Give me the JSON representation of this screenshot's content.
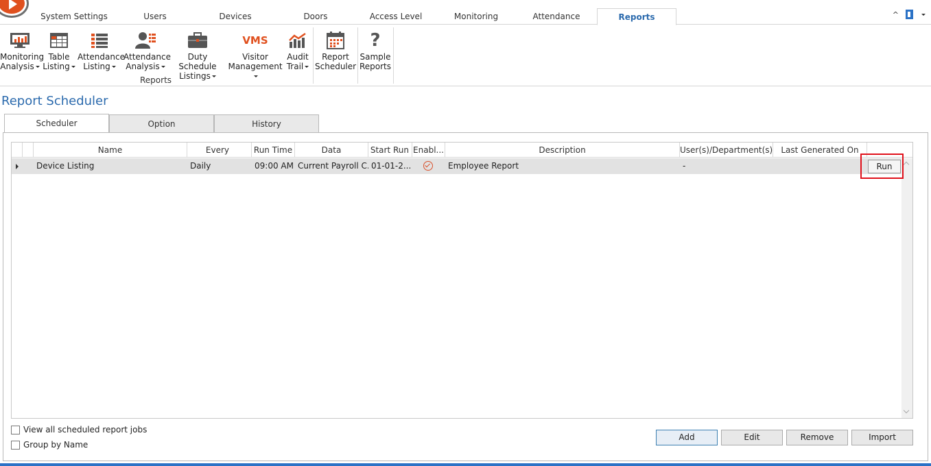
{
  "ribbon": {
    "tabs": [
      "System Settings",
      "Users",
      "Devices",
      "Doors",
      "Access Level",
      "Monitoring",
      "Attendance",
      "Reports"
    ],
    "active_tab": "Reports",
    "buttons": [
      {
        "line1": "Monitoring",
        "line2": "Analysis",
        "icon": "monitor-chart-icon"
      },
      {
        "line1": "Table",
        "line2": "Listing",
        "icon": "table-icon"
      },
      {
        "line1": "Attendance",
        "line2": "Listing",
        "icon": "list-icon"
      },
      {
        "line1": "Attendance",
        "line2": "Analysis",
        "icon": "person-list-icon"
      },
      {
        "line1": "Duty Schedule",
        "line2": "Listings",
        "icon": "briefcase-icon"
      },
      {
        "line1": "Visitor",
        "line2": "Management",
        "icon": "vms-icon",
        "icon_text": "VMS"
      },
      {
        "line1": "Audit",
        "line2": "Trail",
        "icon": "chart-line-icon"
      },
      {
        "line1": "Report",
        "line2": "Scheduler",
        "icon": "calendar-icon"
      },
      {
        "line1": "Sample",
        "line2": "Reports",
        "icon": "question-icon",
        "icon_text": "?"
      }
    ],
    "group_label": "Reports"
  },
  "page": {
    "title": "Report Scheduler",
    "tabs": [
      "Scheduler",
      "Option",
      "History"
    ]
  },
  "grid": {
    "columns": [
      "Name",
      "Every",
      "Run Time",
      "Data",
      "Start Run",
      "Enabl...",
      "Description",
      "User(s)/Department(s)",
      "Last Generated On"
    ],
    "rows": [
      {
        "name": "Device Listing",
        "every": "Daily",
        "run_time": "09:00 AM",
        "data": "Current Payroll C...",
        "start_run": "01-01-2...",
        "enabled": true,
        "description": "Employee Report",
        "users": "-",
        "last_generated": "",
        "action": "Run"
      }
    ]
  },
  "options": {
    "view_all": "View all scheduled report jobs",
    "group_by": "Group by Name"
  },
  "actions": {
    "add": "Add",
    "edit": "Edit",
    "remove": "Remove",
    "import": "Import"
  },
  "colors": {
    "accent": "#2b6aad",
    "brand": "#e0501e",
    "highlight": "#e0101a"
  }
}
